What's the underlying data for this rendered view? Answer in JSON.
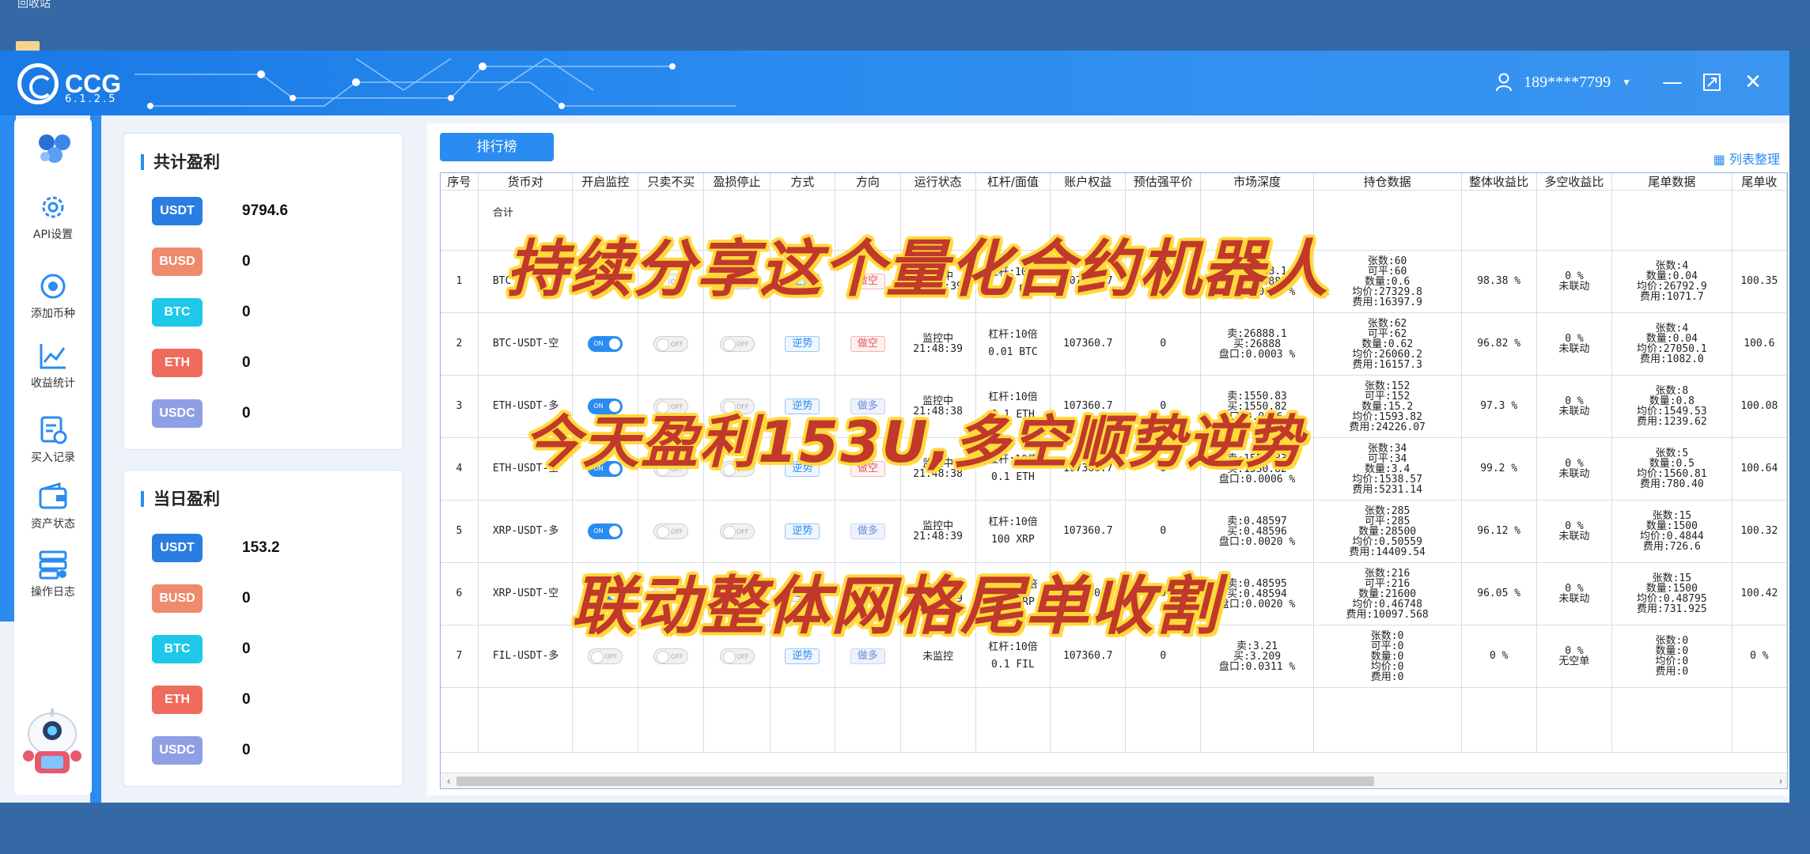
{
  "desktop": {
    "label": "回收站"
  },
  "app": {
    "name": "CCG",
    "version": "6.1.2.5"
  },
  "header": {
    "user": "189****7799"
  },
  "nav": [
    {
      "label": "API设置",
      "icon": "gear-icon"
    },
    {
      "label": "添加币种",
      "icon": "add-coin-icon"
    },
    {
      "label": "收益统计",
      "icon": "chart-icon"
    },
    {
      "label": "买入记录",
      "icon": "record-icon"
    },
    {
      "label": "资产状态",
      "icon": "wallet-icon"
    },
    {
      "label": "操作日志",
      "icon": "log-icon"
    }
  ],
  "total_profit": {
    "title": "共计盈利",
    "coins": [
      {
        "name": "USDT",
        "value": "9794.6",
        "color": "#2a7de1"
      },
      {
        "name": "BUSD",
        "value": "0",
        "color": "#f08a6c"
      },
      {
        "name": "BTC",
        "value": "0",
        "color": "#1ec8e8"
      },
      {
        "name": "ETH",
        "value": "0",
        "color": "#ef6b5d"
      },
      {
        "name": "USDC",
        "value": "0",
        "color": "#8f9fe6"
      }
    ]
  },
  "daily_profit": {
    "title": "当日盈利",
    "coins": [
      {
        "name": "USDT",
        "value": "153.2",
        "color": "#2a7de1"
      },
      {
        "name": "BUSD",
        "value": "0",
        "color": "#f08a6c"
      },
      {
        "name": "BTC",
        "value": "0",
        "color": "#1ec8e8"
      },
      {
        "name": "ETH",
        "value": "0",
        "color": "#ef6b5d"
      },
      {
        "name": "USDC",
        "value": "0",
        "color": "#8f9fe6"
      }
    ]
  },
  "toolbar": {
    "rank_label": "排行榜",
    "list_setting_label": "列表整理"
  },
  "table": {
    "headers": [
      "序号",
      "货币对",
      "开启监控",
      "只卖不买",
      "盈损停止",
      "方式",
      "方向",
      "运行状态",
      "杠杆/面值",
      "账户权益",
      "预估强平价",
      "市场深度",
      "持仓数据",
      "整体收益比",
      "多空收益比",
      "尾单数据",
      "尾单收"
    ],
    "total_label": "合计",
    "rows": [
      {
        "id": "1",
        "pair": "BTC",
        "monitor": "on",
        "sell_only": "off",
        "stop": "off",
        "mode": "逆势",
        "direction": "做空",
        "status": [
          "监控中",
          "21:48:39"
        ],
        "leverage": [
          "杠杆:10倍",
          "0.01 BTC"
        ],
        "equity": "107360.7",
        "liq": "0",
        "depth": [
          "卖:26888.1",
          "买:26888",
          "盘口:0.0003 %"
        ],
        "position": [
          "张数:60",
          "可平:60",
          "数量:0.6",
          "均价:27329.8",
          "费用:16397.9"
        ],
        "total_ratio": "98.38 %",
        "ls_ratio": [
          "0 %",
          "未联动"
        ],
        "tail": [
          "张数:4",
          "数量:0.04",
          "均价:26792.9",
          "费用:1071.7"
        ],
        "tail_ratio": "100.35"
      },
      {
        "id": "2",
        "pair": "BTC-USDT-空",
        "monitor": "on",
        "sell_only": "off",
        "stop": "off",
        "mode": "逆势",
        "direction": "做空",
        "status": [
          "监控中",
          "21:48:39"
        ],
        "leverage": [
          "杠杆:10倍",
          "0.01 BTC"
        ],
        "equity": "107360.7",
        "liq": "0",
        "depth": [
          "卖:26888.1",
          "买:26888",
          "盘口:0.0003 %"
        ],
        "position": [
          "张数:62",
          "可平:62",
          "数量:0.62",
          "均价:26060.2",
          "费用:16157.3"
        ],
        "total_ratio": "96.82 %",
        "ls_ratio": [
          "0 %",
          "未联动"
        ],
        "tail": [
          "张数:4",
          "数量:0.04",
          "均价:27050.1",
          "费用:1082.0"
        ],
        "tail_ratio": "100.6"
      },
      {
        "id": "3",
        "pair": "ETH-USDT-多",
        "monitor": "on",
        "sell_only": "off",
        "stop": "off",
        "mode": "逆势",
        "direction": "做多",
        "status": [
          "监控中",
          "21:48:38"
        ],
        "leverage": [
          "杠杆:10倍",
          "0.1 ETH"
        ],
        "equity": "107360.7",
        "liq": "0",
        "depth": [
          "卖:1550.83",
          "买:1550.82",
          "盘口:0.0006 %"
        ],
        "position": [
          "张数:152",
          "可平:152",
          "数量:15.2",
          "均价:1593.82",
          "费用:24226.07"
        ],
        "total_ratio": "97.3 %",
        "ls_ratio": [
          "0 %",
          "未联动"
        ],
        "tail": [
          "张数:8",
          "数量:0.8",
          "均价:1549.53",
          "费用:1239.62"
        ],
        "tail_ratio": "100.08"
      },
      {
        "id": "4",
        "pair": "ETH-USDT-空",
        "monitor": "on",
        "sell_only": "off",
        "stop": "off",
        "mode": "逆势",
        "direction": "做空",
        "status": [
          "监控中",
          "21:48:38"
        ],
        "leverage": [
          "杠杆:10倍",
          "0.1 ETH"
        ],
        "equity": "107360.7",
        "liq": "0",
        "depth": [
          "卖:1550.83",
          "买:1550.82",
          "盘口:0.0006 %"
        ],
        "position": [
          "张数:34",
          "可平:34",
          "数量:3.4",
          "均价:1538.57",
          "费用:5231.14"
        ],
        "total_ratio": "99.2 %",
        "ls_ratio": [
          "0 %",
          "未联动"
        ],
        "tail": [
          "张数:5",
          "数量:0.5",
          "均价:1560.81",
          "费用:780.40"
        ],
        "tail_ratio": "100.64"
      },
      {
        "id": "5",
        "pair": "XRP-USDT-多",
        "monitor": "on",
        "sell_only": "off",
        "stop": "off",
        "mode": "逆势",
        "direction": "做多",
        "status": [
          "监控中",
          "21:48:39"
        ],
        "leverage": [
          "杠杆:10倍",
          "100 XRP"
        ],
        "equity": "107360.7",
        "liq": "0",
        "depth": [
          "卖:0.48597",
          "买:0.48596",
          "盘口:0.0020 %"
        ],
        "position": [
          "张数:285",
          "可平:285",
          "数量:28500",
          "均价:0.50559",
          "费用:14409.54"
        ],
        "total_ratio": "96.12 %",
        "ls_ratio": [
          "0 %",
          "未联动"
        ],
        "tail": [
          "张数:15",
          "数量:1500",
          "均价:0.4844",
          "费用:726.6"
        ],
        "tail_ratio": "100.32"
      },
      {
        "id": "6",
        "pair": "XRP-USDT-空",
        "monitor": "on",
        "sell_only": "off",
        "stop": "off",
        "mode": "逆势",
        "direction": "做空",
        "status": [
          "监控中",
          "21:48:39"
        ],
        "leverage": [
          "杠杆:10倍",
          "100 XRP"
        ],
        "equity": "107360.7",
        "liq": "0",
        "depth": [
          "卖:0.48595",
          "买:0.48594",
          "盘口:0.0020 %"
        ],
        "position": [
          "张数:216",
          "可平:216",
          "数量:21600",
          "均价:0.46748",
          "费用:10097.568"
        ],
        "total_ratio": "96.05 %",
        "ls_ratio": [
          "0 %",
          "未联动"
        ],
        "tail": [
          "张数:15",
          "数量:1500",
          "均价:0.48795",
          "费用:731.925"
        ],
        "tail_ratio": "100.42"
      },
      {
        "id": "7",
        "pair": "FIL-USDT-多",
        "monitor": "off",
        "sell_only": "off",
        "stop": "off",
        "mode": "逆势",
        "direction": "做多",
        "status": [
          "未监控"
        ],
        "leverage": [
          "杠杆:10倍",
          "0.1 FIL"
        ],
        "equity": "107360.7",
        "liq": "0",
        "depth": [
          "卖:3.21",
          "买:3.209",
          "盘口:0.0311 %"
        ],
        "position": [
          "张数:0",
          "可平:0",
          "数量:0",
          "均价:0",
          "费用:0"
        ],
        "total_ratio": "0 %",
        "ls_ratio": [
          "0 %",
          "无空单"
        ],
        "tail": [
          "张数:0",
          "数量:0",
          "均价:0",
          "费用:0"
        ],
        "tail_ratio": "0 %"
      }
    ]
  },
  "overlay": {
    "line1": "持续分享这个量化合约机器人",
    "line2": "今天盈利153U,多空顺势逆势",
    "line3": "联动整体网格尾单收割",
    "text_color": "#c0392b",
    "outline_color": "#ffd93b"
  }
}
